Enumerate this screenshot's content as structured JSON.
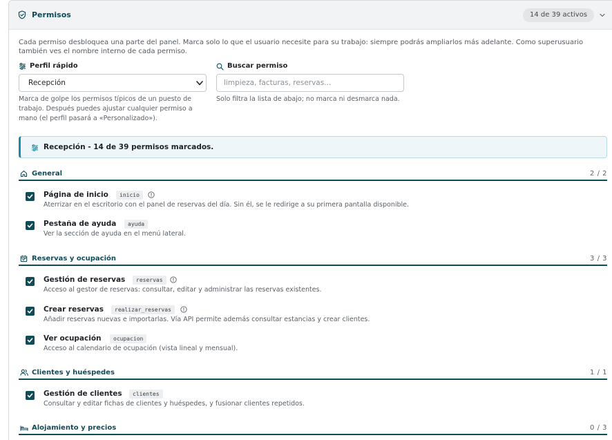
{
  "header": {
    "title": "Permisos",
    "badge": "14 de 39 activos",
    "icon": "shield-check-icon",
    "expand_icon": "chevron-down-icon"
  },
  "intro": "Cada permiso desbloquea una parte del panel. Marca solo lo que el usuario necesite para su trabajo: siempre podrás ampliarlos más adelante. Como superusuario también ves el nombre interno de cada permiso.",
  "quick_profile": {
    "label": "Perfil rápido",
    "value": "Recepción",
    "help": "Marca de golpe los permisos típicos de un puesto de trabajo. Después puedes ajustar cualquier permiso a mano (el perfil pasará a «Personalizado»)."
  },
  "search": {
    "label": "Buscar permiso",
    "placeholder": "limpieza, facturas, reservas...",
    "value": "",
    "help": "Solo filtra la lista de abajo; no marca ni desmarca nada."
  },
  "profile_banner": "Recepción - 14 de 39 permisos marcados.",
  "groups": [
    {
      "title": "General",
      "count": "2 / 2",
      "icon": "home-icon",
      "items": [
        {
          "name": "Página de inicio",
          "code": "inicio",
          "info": true,
          "checked": true,
          "desc": "Aterrizar en el escritorio con el panel de reservas del día. Sin él, se le redirige a su primera pantalla disponible."
        },
        {
          "name": "Pestaña de ayuda",
          "code": "ayuda",
          "info": false,
          "checked": true,
          "desc": "Ver la sección de ayuda en el menú lateral."
        }
      ]
    },
    {
      "title": "Reservas y ocupación",
      "count": "3 / 3",
      "icon": "calendar-icon",
      "items": [
        {
          "name": "Gestión de reservas",
          "code": "reservas",
          "info": true,
          "checked": true,
          "desc": "Acceso al gestor de reservas: consultar, editar y administrar las reservas existentes."
        },
        {
          "name": "Crear reservas",
          "code": "realizar_reservas",
          "info": true,
          "checked": true,
          "desc": "Añadir reservas nuevas e importarlas. Vía API permite además consultar estancias y crear clientes."
        },
        {
          "name": "Ver ocupación",
          "code": "ocupacion",
          "info": false,
          "checked": true,
          "desc": "Acceso al calendario de ocupación (vista lineal y mensual)."
        }
      ]
    },
    {
      "title": "Clientes y huéspedes",
      "count": "1 / 1",
      "icon": "users-icon",
      "items": [
        {
          "name": "Gestión de clientes",
          "code": "clientes",
          "info": false,
          "checked": true,
          "desc": "Consultar y editar fichas de clientes y huéspedes, y fusionar clientes repetidos."
        }
      ]
    },
    {
      "title": "Alojamiento y precios",
      "count": "0 / 3",
      "icon": "bed-icon",
      "items": []
    }
  ]
}
